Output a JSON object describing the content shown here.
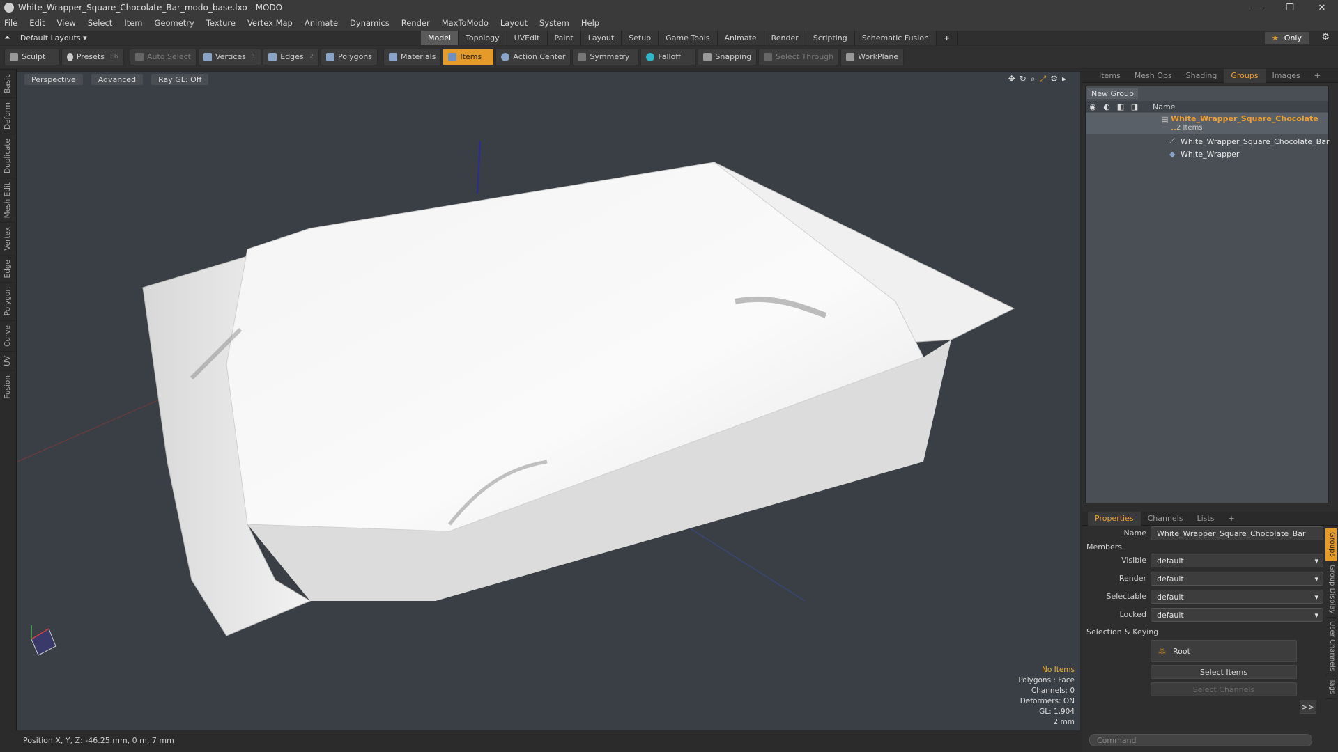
{
  "window": {
    "title": "White_Wrapper_Square_Chocolate_Bar_modo_base.lxo - MODO",
    "controls": [
      "—",
      "❐",
      "✕"
    ]
  },
  "menu": [
    "File",
    "Edit",
    "View",
    "Select",
    "Item",
    "Geometry",
    "Texture",
    "Vertex Map",
    "Animate",
    "Dynamics",
    "Render",
    "MaxToModo",
    "Layout",
    "System",
    "Help"
  ],
  "layouts": {
    "label": "Default Layouts ▾"
  },
  "tabs": [
    {
      "label": "Model",
      "active": true
    },
    {
      "label": "Topology"
    },
    {
      "label": "UVEdit"
    },
    {
      "label": "Paint"
    },
    {
      "label": "Layout"
    },
    {
      "label": "Setup"
    },
    {
      "label": "Game Tools"
    },
    {
      "label": "Animate"
    },
    {
      "label": "Render"
    },
    {
      "label": "Scripting"
    },
    {
      "label": "Schematic Fusion"
    },
    {
      "label": "+"
    }
  ],
  "only": {
    "label": "Only"
  },
  "toolbar": {
    "sculpt": "Sculpt",
    "presets": "Presets",
    "presets_key": "F6",
    "auto_select": "Auto Select",
    "vertices": "Vertices",
    "vertices_key": "1",
    "edges": "Edges",
    "edges_key": "2",
    "polygons": "Polygons",
    "materials": "Materials",
    "items": "Items",
    "action_center": "Action Center",
    "symmetry": "Symmetry",
    "falloff": "Falloff",
    "snapping": "Snapping",
    "select_through": "Select Through",
    "workplane": "WorkPlane"
  },
  "left_tabs": [
    "Basic",
    "Deform",
    "Duplicate",
    "Mesh Edit",
    "Vertex",
    "Edge",
    "Polygon",
    "Curve",
    "UV",
    "Fusion"
  ],
  "viewport": {
    "perspective": "Perspective",
    "advanced": "Advanced",
    "raygl": "Ray GL: Off",
    "stats": {
      "items": "No Items",
      "polygons": "Polygons : Face",
      "channels": "Channels: 0",
      "deformers": "Deformers: ON",
      "gl": "GL: 1,904",
      "scale": "2 mm"
    }
  },
  "status": {
    "position": "Position X, Y, Z:  -46.25 mm, 0 m, 7 mm"
  },
  "panel_tabs": [
    "Items",
    "Mesh Ops",
    "Shading",
    "Groups",
    "Images",
    "+"
  ],
  "groups": {
    "new_group": "New Group",
    "col_name": "Name",
    "group_name": "White_Wrapper_Square_Chocolate ...",
    "group_count": "2 Items",
    "items": [
      "White_Wrapper_Square_Chocolate_Bar",
      "White_Wrapper"
    ]
  },
  "props_tabs": [
    "Properties",
    "Channels",
    "Lists",
    "+"
  ],
  "properties": {
    "name_label": "Name",
    "name_value": "White_Wrapper_Square_Chocolate_Bar",
    "members": "Members",
    "visible_label": "Visible",
    "visible": "default",
    "render_label": "Render",
    "render": "default",
    "selectable_label": "Selectable",
    "selectable": "default",
    "locked_label": "Locked",
    "locked": "default",
    "sel_keying": "Selection & Keying",
    "root": "Root",
    "select_items": "Select Items",
    "select_channels": "Select Channels",
    "more": ">>"
  },
  "vtabs": [
    "Groups",
    "Group Display",
    "User Channels",
    "Tags"
  ],
  "command": {
    "placeholder": "Command"
  }
}
